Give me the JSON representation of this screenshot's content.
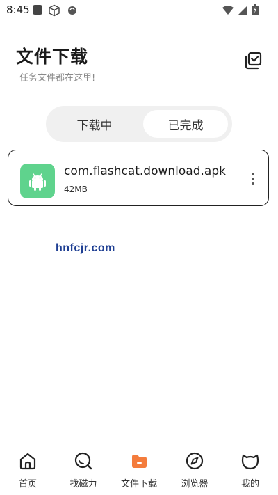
{
  "status_bar": {
    "time": "8:45"
  },
  "header": {
    "title": "文件下载",
    "subtitle": "任务文件都在这里!"
  },
  "tabs": [
    {
      "label": "下载中",
      "selected": false
    },
    {
      "label": "已完成",
      "selected": true
    }
  ],
  "files": [
    {
      "name": "com.flashcat.download.apk",
      "size": "42MB",
      "icon": "android-icon"
    }
  ],
  "watermark": "hnfcjr.com",
  "bottom_nav": [
    {
      "label": "首页",
      "icon": "home-icon",
      "active": false
    },
    {
      "label": "找磁力",
      "icon": "search-icon",
      "active": false
    },
    {
      "label": "文件下载",
      "icon": "folder-icon",
      "active": true
    },
    {
      "label": "浏览器",
      "icon": "compass-icon",
      "active": false
    },
    {
      "label": "我的",
      "icon": "cat-face-icon",
      "active": false
    }
  ],
  "colors": {
    "accent": "#f47c3c",
    "android_green": "#5fd38d",
    "watermark": "#1f3f93"
  }
}
